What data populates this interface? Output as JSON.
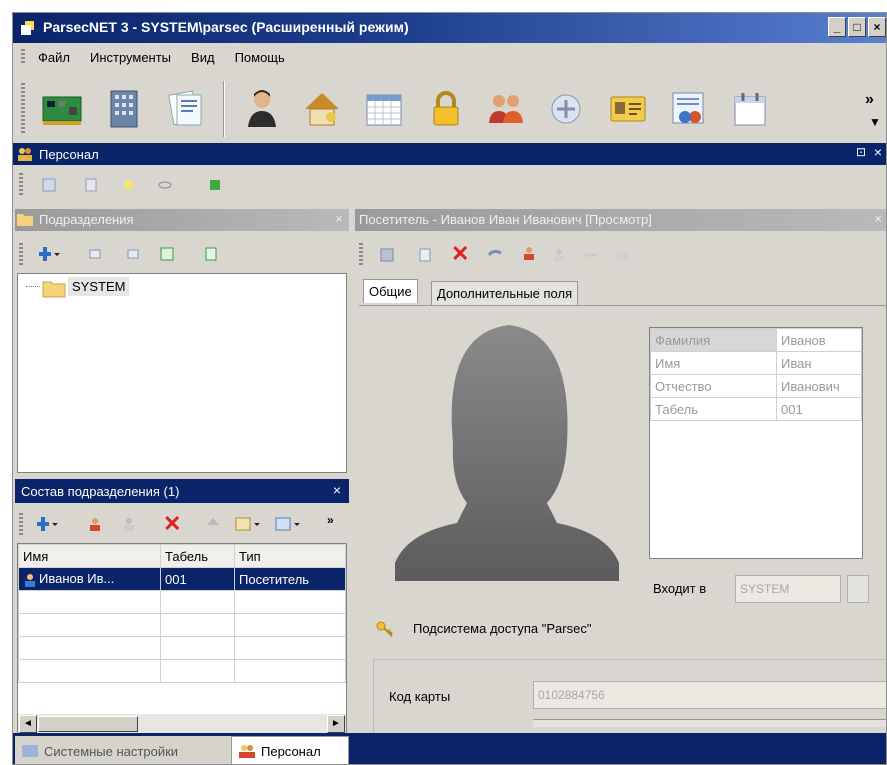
{
  "window": {
    "title": "ParsecNET 3 - SYSTEM\\parsec (Расширенный режим)",
    "controls": [
      "_",
      "□",
      "×"
    ]
  },
  "menu": [
    "Файл",
    "Инструменты",
    "Вид",
    "Помощь"
  ],
  "toolbar": {
    "icons": [
      "hardware-icon",
      "building-icon",
      "documents-icon",
      "person-icon",
      "home-key-icon",
      "calendar-grid-icon",
      "padlock-icon",
      "users-icon",
      "network-icon",
      "card-icon",
      "reports-icon",
      "schedule-icon"
    ],
    "overflow": "»"
  },
  "personal_panel": {
    "title": "Персонал",
    "pin": "⊡",
    "close": "×"
  },
  "departments": {
    "title": "Подразделения",
    "close": "×",
    "tree_root": "SYSTEM"
  },
  "composition": {
    "title": "Состав подразделения (1)",
    "close": "×",
    "columns": [
      "Имя",
      "Табель",
      "Тип"
    ],
    "rows": [
      {
        "name": "Иванов Ив...",
        "tab": "001",
        "type": "Посетитель"
      }
    ]
  },
  "visitor": {
    "title": "Посетитель - Иванов Иван Иванович [Просмотр]",
    "close": "×",
    "tabs": [
      "Общие",
      "Дополнительные поля"
    ],
    "fields": [
      {
        "label": "Фамилия",
        "value": "Иванов"
      },
      {
        "label": "Имя",
        "value": "Иван"
      },
      {
        "label": "Отчество",
        "value": "Иванович"
      },
      {
        "label": "Табель",
        "value": "001"
      }
    ],
    "member_of_label": "Входит в",
    "member_of_value": "SYSTEM",
    "subsystem_label": "Подсистема доступа \"Parsec\"",
    "card_code_label": "Код карты",
    "card_code_value": "0102884756"
  },
  "bottom_tabs": [
    "Системные настройки",
    "Персонал"
  ],
  "colors": {
    "title_active": "#0a246a",
    "title_inactive": "#a9a9a9",
    "selection": "#0a246a",
    "chrome": "#d8d6cf"
  }
}
